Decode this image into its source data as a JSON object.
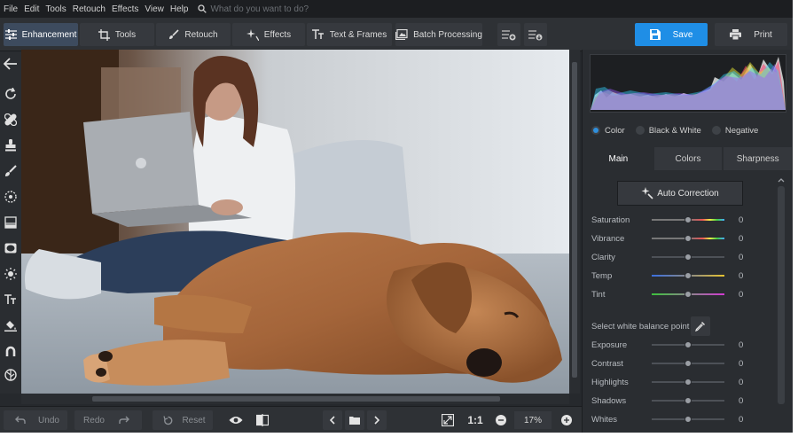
{
  "menu": {
    "items": [
      "File",
      "Edit",
      "Tools",
      "Retouch",
      "Effects",
      "View",
      "Help"
    ],
    "search_placeholder": "What do you want to do?"
  },
  "toolbar": {
    "tabs": [
      {
        "label": "Enhancement",
        "icon": "sliders-icon",
        "active": true
      },
      {
        "label": "Tools",
        "icon": "crop-icon"
      },
      {
        "label": "Retouch",
        "icon": "brush-icon"
      },
      {
        "label": "Effects",
        "icon": "sparkle-icon"
      },
      {
        "label": "Text & Frames",
        "icon": "text-icon"
      },
      {
        "label": "Batch Processing",
        "icon": "images-icon"
      }
    ],
    "save_label": "Save",
    "print_label": "Print"
  },
  "bottom": {
    "undo_label": "Undo",
    "redo_label": "Redo",
    "reset_label": "Reset",
    "zoom_ratio_label": "1:1",
    "zoom_value": "17%"
  },
  "panel": {
    "modes": [
      {
        "label": "Color",
        "selected": true
      },
      {
        "label": "Black & White",
        "selected": false
      },
      {
        "label": "Negative",
        "selected": false
      }
    ],
    "tabs": [
      {
        "label": "Main",
        "active": true
      },
      {
        "label": "Colors",
        "active": false
      },
      {
        "label": "Sharpness",
        "active": false
      }
    ],
    "auto_correction_label": "Auto Correction",
    "sliders_top": [
      {
        "label": "Saturation",
        "value": "0"
      },
      {
        "label": "Vibrance",
        "value": "0"
      },
      {
        "label": "Clarity",
        "value": "0"
      },
      {
        "label": "Temp",
        "value": "0"
      },
      {
        "label": "Tint",
        "value": "0"
      }
    ],
    "white_balance_label": "Select white balance point",
    "sliders_bottom": [
      {
        "label": "Exposure",
        "value": "0"
      },
      {
        "label": "Contrast",
        "value": "0"
      },
      {
        "label": "Highlights",
        "value": "0"
      },
      {
        "label": "Shadows",
        "value": "0"
      },
      {
        "label": "Whites",
        "value": "0"
      }
    ]
  },
  "colors": {
    "accent": "#1f8ee6",
    "background": "#26292d"
  }
}
